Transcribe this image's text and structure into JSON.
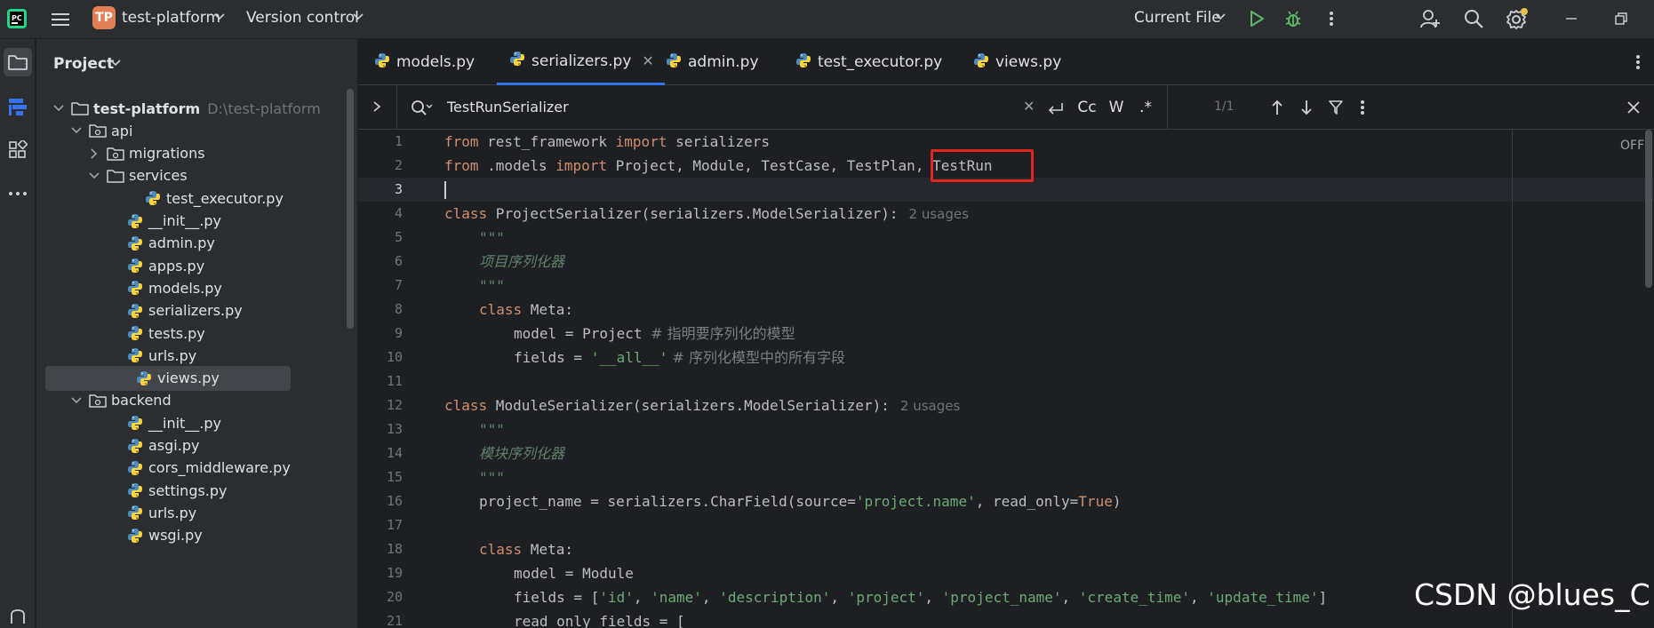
{
  "titlebar": {
    "project_badge": "TP",
    "project_name": "test-platform",
    "vcs_label": "Version control",
    "run_config": "Current File"
  },
  "project_panel": {
    "title": "Project",
    "root": {
      "label": "test-platform",
      "path": "D:\\test-platform"
    },
    "items": [
      {
        "label": "api",
        "type": "folder",
        "expanded": true
      },
      {
        "label": "migrations",
        "type": "folder",
        "expanded": false
      },
      {
        "label": "services",
        "type": "folder",
        "expanded": true
      },
      {
        "label": "test_executor.py",
        "type": "python"
      },
      {
        "label": "__init__.py",
        "type": "python"
      },
      {
        "label": "admin.py",
        "type": "python"
      },
      {
        "label": "apps.py",
        "type": "python"
      },
      {
        "label": "models.py",
        "type": "python"
      },
      {
        "label": "serializers.py",
        "type": "python"
      },
      {
        "label": "tests.py",
        "type": "python"
      },
      {
        "label": "urls.py",
        "type": "python"
      },
      {
        "label": "views.py",
        "type": "python",
        "selected": true
      },
      {
        "label": "backend",
        "type": "folder",
        "expanded": true
      },
      {
        "label": "__init__.py",
        "type": "python"
      },
      {
        "label": "asgi.py",
        "type": "python"
      },
      {
        "label": "cors_middleware.py",
        "type": "python"
      },
      {
        "label": "settings.py",
        "type": "python"
      },
      {
        "label": "urls.py",
        "type": "python"
      },
      {
        "label": "wsgi.py",
        "type": "python"
      }
    ]
  },
  "tabs": [
    {
      "label": "models.py"
    },
    {
      "label": "serializers.py",
      "active": true
    },
    {
      "label": "admin.py"
    },
    {
      "label": "test_executor.py"
    },
    {
      "label": "views.py"
    }
  ],
  "find": {
    "query": "TestRunSerializer",
    "case_label": "Cc",
    "word_label": "W",
    "regex_label": ".*",
    "match_count": "1/1"
  },
  "editor": {
    "off_label": "OFF",
    "usages_label": "2 usages",
    "line_numbers": [
      "1",
      "2",
      "3",
      "4",
      "5",
      "6",
      "7",
      "8",
      "9",
      "10",
      "11",
      "12",
      "13",
      "14",
      "15",
      "16",
      "17",
      "18",
      "19",
      "20",
      "21"
    ],
    "lines": {
      "l1": {
        "kw1": "from",
        "mod": " rest_framework ",
        "kw2": "import",
        "rest": " serializers"
      },
      "l2": {
        "kw1": "from",
        "mod": " .models ",
        "kw2": "import",
        "rest": " Project, Module, TestCase, TestPlan, TestRun"
      },
      "l4": {
        "kw": "class",
        "rest": " ProjectSerializer(serializers.ModelSerializer):"
      },
      "l5": "\"\"\"",
      "l6": "项目序列化器",
      "l7": "\"\"\"",
      "l8": {
        "kw": "class",
        "rest": " Meta:"
      },
      "l9": {
        "code": "model = Project ",
        "cmt": "# 指明要序列化的模型"
      },
      "l10": {
        "code": "fields = ",
        "str": "'__all__'",
        "cmt": " # 序列化模型中的所有字段"
      },
      "l12": {
        "kw": "class",
        "rest": " ModuleSerializer(serializers.ModelSerializer):"
      },
      "l13": "\"\"\"",
      "l14": "模块序列化器",
      "l15": "\"\"\"",
      "l16": {
        "pre": "project_name = serializers.CharField(source=",
        "str": "'project.name'",
        "mid": ", read_only=",
        "kw": "True",
        "post": ")"
      },
      "l18": {
        "kw": "class",
        "rest": " Meta:"
      },
      "l19": "model = Module",
      "l20": {
        "pre": "fields = [",
        "s1": "'id'",
        "s2": "'name'",
        "s3": "'description'",
        "s4": "'project'",
        "s5": "'project_name'",
        "s6": "'create_time'",
        "s7": "'update_time'",
        "post": "]"
      },
      "l21": "read_only_fields = ["
    }
  },
  "watermark": "CSDN @blues_C",
  "colors": {
    "accent": "#3574f0",
    "highlight_box": "#e3251f",
    "badge": "#e37e54"
  }
}
